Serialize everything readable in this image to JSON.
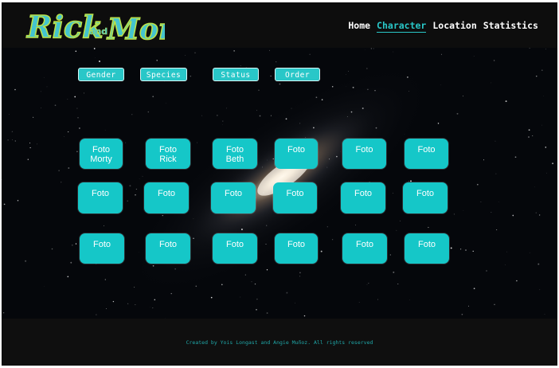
{
  "header": {
    "logo_text": "Rick and Morty",
    "nav": [
      "Home",
      "Character",
      "Location",
      "Statistics"
    ],
    "active": "Character"
  },
  "filters": [
    "Gender",
    "Species",
    "Status",
    "Order"
  ],
  "cards": [
    [
      "Foto",
      "Morty"
    ],
    [
      "Foto",
      "Rick"
    ],
    [
      "Foto",
      "Beth"
    ],
    [
      "Foto"
    ],
    [
      "Foto"
    ],
    [
      "Foto"
    ],
    [
      "Foto"
    ],
    [
      "Foto"
    ],
    [
      "Foto"
    ],
    [
      "Foto"
    ],
    [
      "Foto"
    ],
    [
      "Foto"
    ],
    [
      "Foto"
    ],
    [
      "Foto"
    ],
    [
      "Foto"
    ],
    [
      "Foto"
    ],
    [
      "Foto"
    ],
    [
      "Foto"
    ]
  ],
  "footer": {
    "text": "Created by Yois Longast and Angie Muñoz. All rights reserved"
  },
  "colors": {
    "accent": "#29c7c8",
    "card": "#15c7c8",
    "background": "#05070b"
  }
}
